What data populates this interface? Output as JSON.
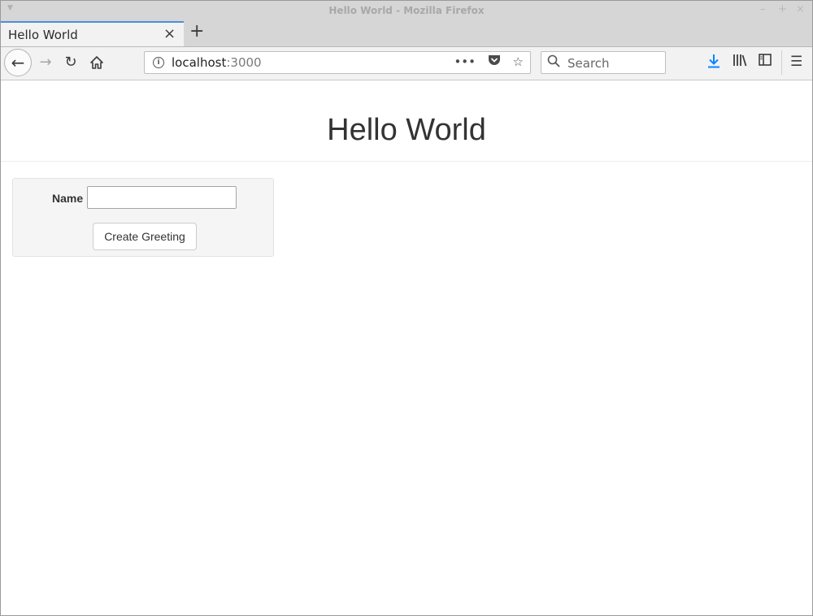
{
  "window": {
    "title": "Hello World - Mozilla Firefox"
  },
  "tabs": [
    {
      "label": "Hello World",
      "active": true
    }
  ],
  "navbar": {
    "url_host": "localhost",
    "url_port": ":3000",
    "search_placeholder": "Search"
  },
  "icons": {
    "back": "arrow-left-icon",
    "forward": "arrow-right-icon",
    "reload": "reload-icon",
    "home": "home-icon",
    "info": "info-icon",
    "more": "more-dots-icon",
    "pocket": "pocket-icon",
    "bookmark": "star-icon",
    "search": "search-icon",
    "download": "download-icon",
    "library": "library-icon",
    "sidebar": "sidebar-icon",
    "menu": "hamburger-menu-icon"
  },
  "colors": {
    "accent": "#4a90d9",
    "download": "#0a84ff"
  },
  "page": {
    "heading": "Hello World",
    "form": {
      "name_label": "Name",
      "name_value": "",
      "submit_label": "Create Greeting"
    }
  }
}
